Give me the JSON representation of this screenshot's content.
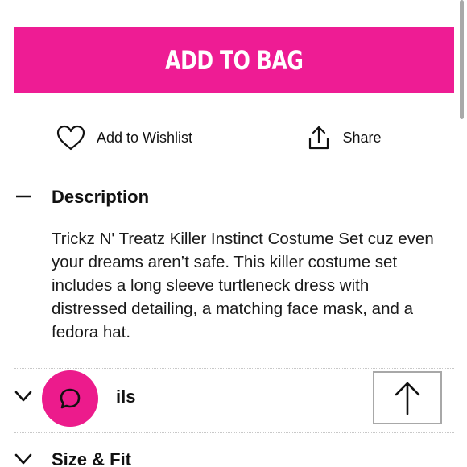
{
  "cta": {
    "add_to_bag_label": "ADD TO BAG",
    "color": "#ee1c94"
  },
  "actions": {
    "wishlist_label": "Add to Wishlist",
    "wishlist_icon": "heart-icon",
    "share_label": "Share",
    "share_icon": "share-icon"
  },
  "description": {
    "title": "Description",
    "toggle_icon": "minus-icon",
    "text": "Trickz N' Treatz Killer Instinct Costume Set cuz even your dreams aren’t safe. This killer costume set includes a long sleeve turtleneck dress with distressed detailing, a matching face mask, and a fedora hat."
  },
  "details": {
    "title": "Details",
    "visible_title": "ils",
    "toggle_icon": "chevron-down-icon"
  },
  "size_fit": {
    "title": "Size & Fit",
    "toggle_icon": "chevron-down-icon"
  },
  "chat": {
    "icon": "chat-bubble-icon",
    "color": "#ec1b8c"
  },
  "back_to_top": {
    "icon": "arrow-up-icon"
  }
}
